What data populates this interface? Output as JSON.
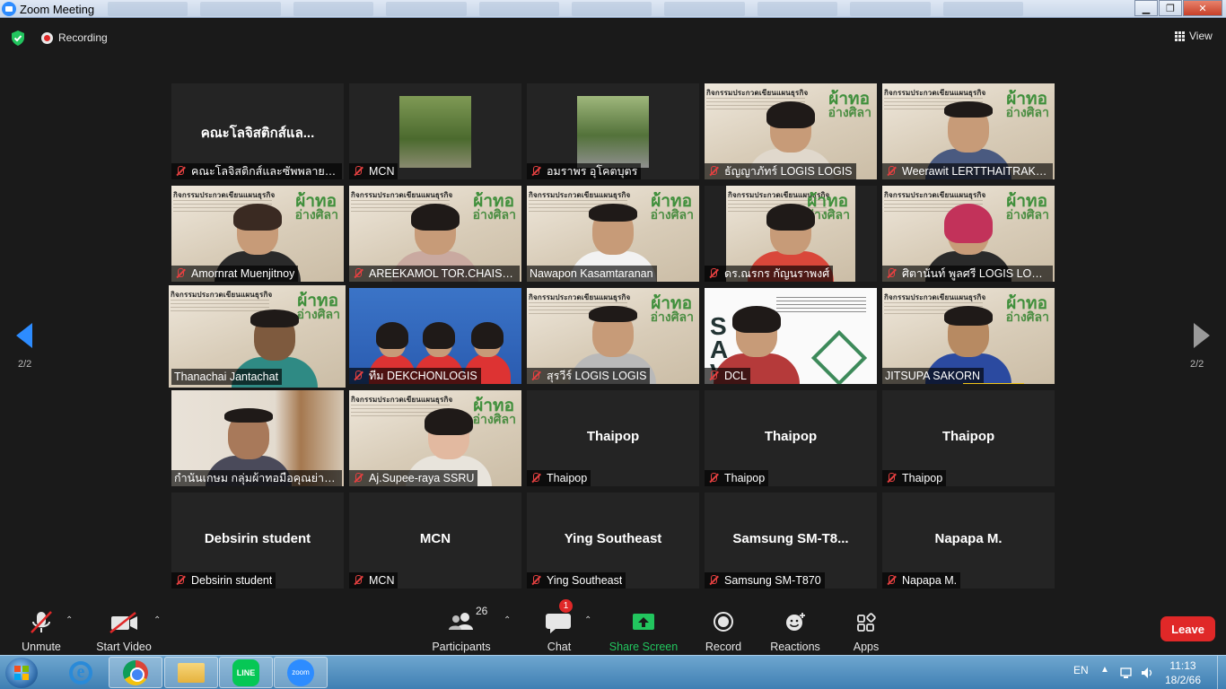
{
  "window": {
    "title": "Zoom Meeting"
  },
  "topbar": {
    "recording_label": "Recording",
    "view_label": "View"
  },
  "pagination": {
    "left": "2/2",
    "right": "2/2"
  },
  "tiles": [
    {
      "center": "คณะโลจิสติกส์แล...",
      "name": "คณะโลจิสติกส์และซัพพลายเช..."
    },
    {
      "name": "MCN"
    },
    {
      "name": "อมราพร อุโคตบุตร"
    },
    {
      "name": "ธัญญาภัทร์ LOGIS LOGIS"
    },
    {
      "name": "Weerawit LERTTHAITRAKU..."
    },
    {
      "name": "Amornrat  Muenjitnoy"
    },
    {
      "name": "AREEKAMOL TOR.CHAISU..."
    },
    {
      "name": "Nawapon Kasamtaranan"
    },
    {
      "name": "ดร.ณรกร กัญนราพงศ์"
    },
    {
      "name": "ศิตานันท์ พูลศรี LOGIS LOGIS"
    },
    {
      "name": "Thanachai Jantachat"
    },
    {
      "name": "ทีม DEKCHONLOGIS"
    },
    {
      "name": "สุรวีร์ LOGIS LOGIS"
    },
    {
      "name": "DCL"
    },
    {
      "name": "JITSUPA  SAKORN"
    },
    {
      "name": "กำนันเกษม กลุ่มผ้าทอมือคุณย่าห..."
    },
    {
      "name": "Aj.Supee-raya SSRU"
    },
    {
      "center": "Thaipop",
      "name": "Thaipop"
    },
    {
      "center": "Thaipop",
      "name": "Thaipop"
    },
    {
      "center": "Thaipop",
      "name": "Thaipop"
    },
    {
      "center": "Debsirin student",
      "name": "Debsirin student"
    },
    {
      "center": "MCN",
      "name": "MCN"
    },
    {
      "center": "Ying Southeast",
      "name": "Ying Southeast"
    },
    {
      "center": "Samsung  SM-T8...",
      "name": "Samsung SM-T870"
    },
    {
      "center": "Napapa M.",
      "name": "Napapa M."
    }
  ],
  "slide": {
    "header": "กิจกรรมประกวดเขียนแผนธุรกิจ",
    "brand": "ผ้าทอ",
    "brand2": "อ่างศิลา"
  },
  "poster": {
    "big": "S\nA\nV"
  },
  "toolbar": {
    "unmute": "Unmute",
    "start_video": "Start Video",
    "participants": "Participants",
    "participants_count": "26",
    "chat": "Chat",
    "chat_badge": "1",
    "share": "Share Screen",
    "record": "Record",
    "reactions": "Reactions",
    "apps": "Apps",
    "leave": "Leave"
  },
  "taskbar": {
    "line_label": "LINE",
    "zoom_label": "zoom",
    "lang": "EN",
    "time": "11:13",
    "date": "18/2/66"
  },
  "colors": {
    "accent": "#2d8cff",
    "leave": "#e02828",
    "share": "#22c55e",
    "active_speaker": "#d8e85a"
  }
}
